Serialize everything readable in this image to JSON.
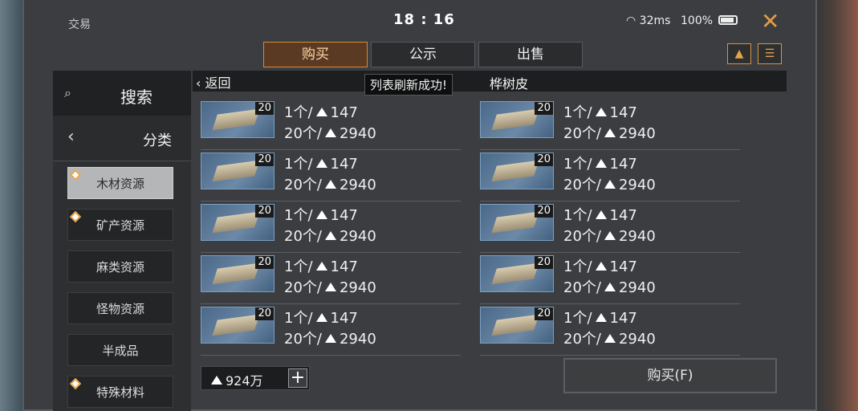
{
  "header": {
    "app_title": "交易",
    "clock": "18 : 16",
    "network": "32ms",
    "battery": "100%",
    "close_icon": "close-icon"
  },
  "tabs": [
    {
      "label": "购买",
      "active": true
    },
    {
      "label": "公示",
      "active": false
    },
    {
      "label": "出售",
      "active": false
    }
  ],
  "top_icons": [
    "hierarchy-icon",
    "notes-icon"
  ],
  "sidebar": {
    "search_label": "搜索",
    "category_label": "分类",
    "items": [
      {
        "label": "木材资源",
        "active": true,
        "marked": true
      },
      {
        "label": "矿产资源",
        "active": false,
        "marked": true
      },
      {
        "label": "麻类资源",
        "active": false,
        "marked": false
      },
      {
        "label": "怪物资源",
        "active": false,
        "marked": false
      },
      {
        "label": "半成品",
        "active": false,
        "marked": false
      },
      {
        "label": "特殊材料",
        "active": false,
        "marked": true
      }
    ]
  },
  "main": {
    "back_label": "返回",
    "category_title": "桦树皮",
    "toast": "列表刷新成功!",
    "listings": [
      {
        "qty": "20",
        "unit_price_label": "1个/",
        "unit_price": "147",
        "stack_label": "20个/",
        "stack_price": "2940"
      },
      {
        "qty": "20",
        "unit_price_label": "1个/",
        "unit_price": "147",
        "stack_label": "20个/",
        "stack_price": "2940"
      },
      {
        "qty": "20",
        "unit_price_label": "1个/",
        "unit_price": "147",
        "stack_label": "20个/",
        "stack_price": "2940"
      },
      {
        "qty": "20",
        "unit_price_label": "1个/",
        "unit_price": "147",
        "stack_label": "20个/",
        "stack_price": "2940"
      },
      {
        "qty": "20",
        "unit_price_label": "1个/",
        "unit_price": "147",
        "stack_label": "20个/",
        "stack_price": "2940"
      },
      {
        "qty": "20",
        "unit_price_label": "1个/",
        "unit_price": "147",
        "stack_label": "20个/",
        "stack_price": "2940"
      },
      {
        "qty": "20",
        "unit_price_label": "1个/",
        "unit_price": "147",
        "stack_label": "20个/",
        "stack_price": "2940"
      },
      {
        "qty": "20",
        "unit_price_label": "1个/",
        "unit_price": "147",
        "stack_label": "20个/",
        "stack_price": "2940"
      },
      {
        "qty": "20",
        "unit_price_label": "1个/",
        "unit_price": "147",
        "stack_label": "20个/",
        "stack_price": "2940"
      },
      {
        "qty": "20",
        "unit_price_label": "1个/",
        "unit_price": "147",
        "stack_label": "20个/",
        "stack_price": "2940"
      }
    ],
    "balance": "924万",
    "buy_button": "购买(F)"
  },
  "colors": {
    "accent": "#d88a3a",
    "panel": "#3b3d40"
  }
}
